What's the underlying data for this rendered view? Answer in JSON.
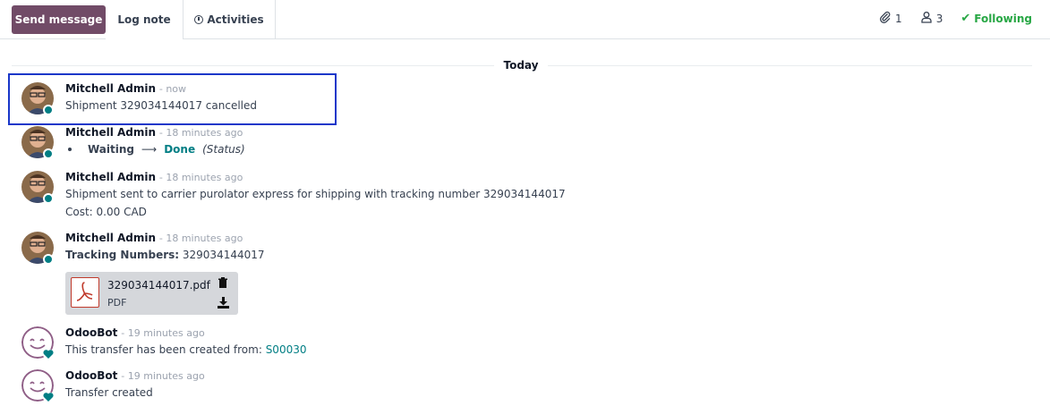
{
  "toolbar": {
    "send_message": "Send message",
    "log_note": "Log note",
    "activities": "Activities",
    "attachments_count": "1",
    "followers_count": "3",
    "following": "Following"
  },
  "day_separator": "Today",
  "messages": [
    {
      "author": "Mitchell Admin",
      "time": "- now",
      "text": "Shipment 329034144017 cancelled"
    },
    {
      "author": "Mitchell Admin",
      "time": "- 18 minutes ago",
      "old_value": "Waiting",
      "new_value": "Done",
      "field": "(Status)"
    },
    {
      "author": "Mitchell Admin",
      "time": "- 18 minutes ago",
      "text": "Shipment sent to carrier purolator express for shipping with tracking number 329034144017",
      "text2": "Cost: 0.00 CAD"
    },
    {
      "author": "Mitchell Admin",
      "time": "- 18 minutes ago",
      "label": "Tracking Numbers:",
      "text": " 329034144017",
      "attachment": {
        "name": "329034144017.pdf",
        "type": "PDF"
      }
    },
    {
      "author": "OdooBot",
      "time": "- 19 minutes ago",
      "text": "This transfer has been created from: ",
      "link": "S00030"
    },
    {
      "author": "OdooBot",
      "time": "- 19 minutes ago",
      "text": "Transfer created"
    }
  ],
  "colors": {
    "primary": "#714b67",
    "teal": "#017e84",
    "following": "#28a745",
    "highlight_border": "#1a37c9"
  }
}
